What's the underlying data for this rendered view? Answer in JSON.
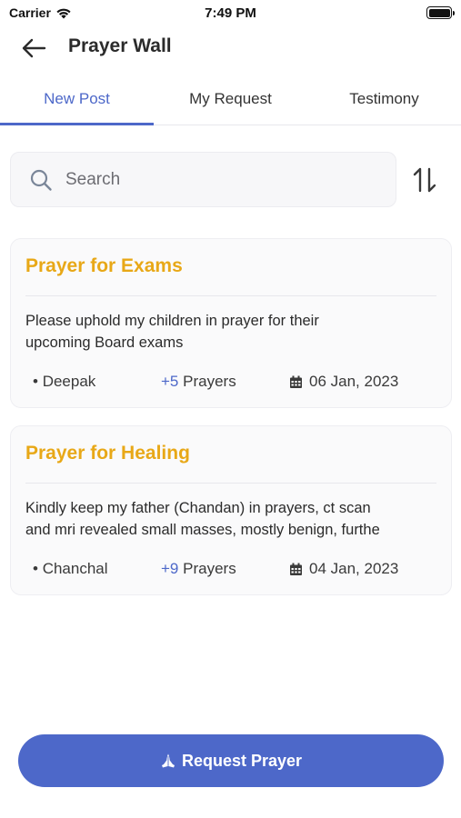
{
  "status_bar": {
    "carrier": "Carrier",
    "time": "7:49 PM"
  },
  "header": {
    "title": "Prayer Wall"
  },
  "tabs": [
    {
      "label": "New Post",
      "active": true
    },
    {
      "label": "My Request",
      "active": false
    },
    {
      "label": "Testimony",
      "active": false
    }
  ],
  "search": {
    "placeholder": "Search",
    "value": ""
  },
  "posts": [
    {
      "title": "Prayer for Exams",
      "body_line1": "Please uphold my children in prayer for their",
      "body_line2": "upcoming Board exams",
      "author": "Deepak",
      "prayer_count": "+5",
      "prayer_label": "Prayers",
      "date": "06 Jan, 2023"
    },
    {
      "title": "Prayer for Healing",
      "body_line1": "Kindly keep my father (Chandan) in prayers, ct scan",
      "body_line2": "and mri revealed small masses, mostly benign, furthe",
      "author": "Chanchal",
      "prayer_count": "+9",
      "prayer_label": "Prayers",
      "date": "04 Jan, 2023"
    }
  ],
  "footer": {
    "request_button_label": "Request Prayer"
  },
  "colors": {
    "accent": "#4d68c9",
    "title": "#e8a817"
  },
  "icons": [
    "wifi-icon",
    "battery-icon",
    "back-arrow-icon",
    "search-icon",
    "sort-icon",
    "calendar-icon",
    "praying-hands-icon"
  ]
}
